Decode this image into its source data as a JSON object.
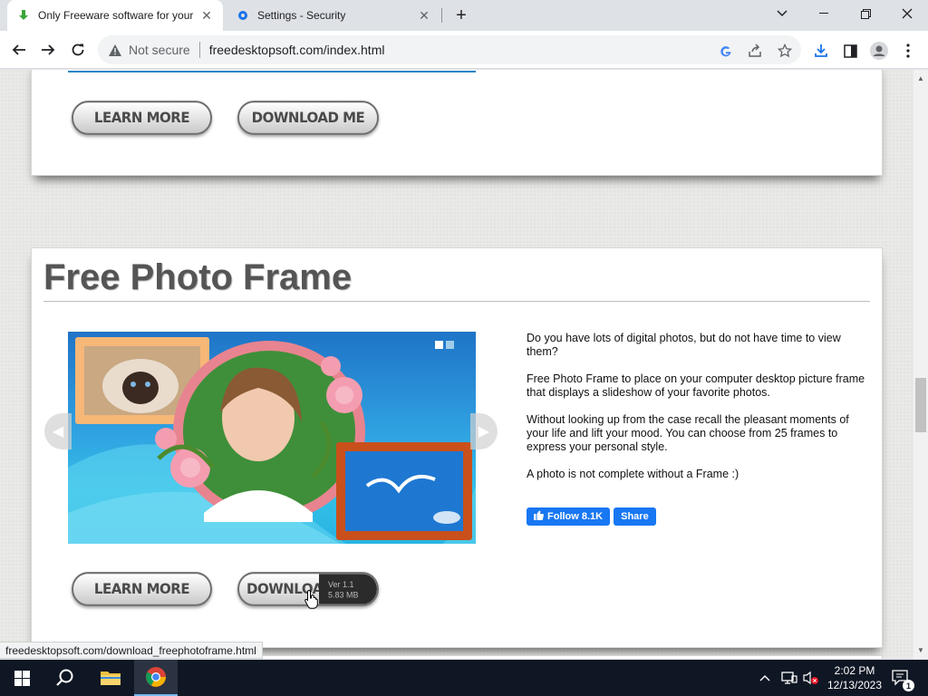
{
  "browser": {
    "tabs": [
      {
        "title": "Only Freeware software for your",
        "icon": "download-arrow-icon",
        "active": true
      },
      {
        "title": "Settings - Security",
        "icon": "gear-icon",
        "active": false
      }
    ],
    "security_label": "Not secure",
    "url": "freedesktopsoft.com/index.html"
  },
  "top_panel": {
    "learn_more_label": "LEARN MORE",
    "download_label": "DOWNLOAD ME"
  },
  "product": {
    "title": "Free Photo Frame",
    "description": [
      "Do you have lots of digital photos, but do not have time to view them?",
      "Free Photo Frame to place on your computer desktop picture frame that displays a slideshow of your favorite photos.",
      "Without looking up from the case recall the pleasant moments of your life and lift your mood. You can choose from 25 frames to express your personal style.",
      "A photo is not complete without a Frame :)"
    ],
    "fb_follow_label": "Follow 8.1K",
    "fb_share_label": "Share",
    "learn_more_label": "LEARN MORE",
    "download_label": "DOWNLOAD ME",
    "version_label": "Ver 1.1",
    "size_label": "5.83 MB"
  },
  "status_bar_url": "freedesktopsoft.com/download_freephotoframe.html",
  "taskbar": {
    "time": "2:02 PM",
    "date": "12/13/2023",
    "notification_count": "1"
  },
  "colors": {
    "accent_blue": "#1a73e8",
    "facebook_blue": "#1877f2",
    "taskbar_bg": "#101724"
  }
}
